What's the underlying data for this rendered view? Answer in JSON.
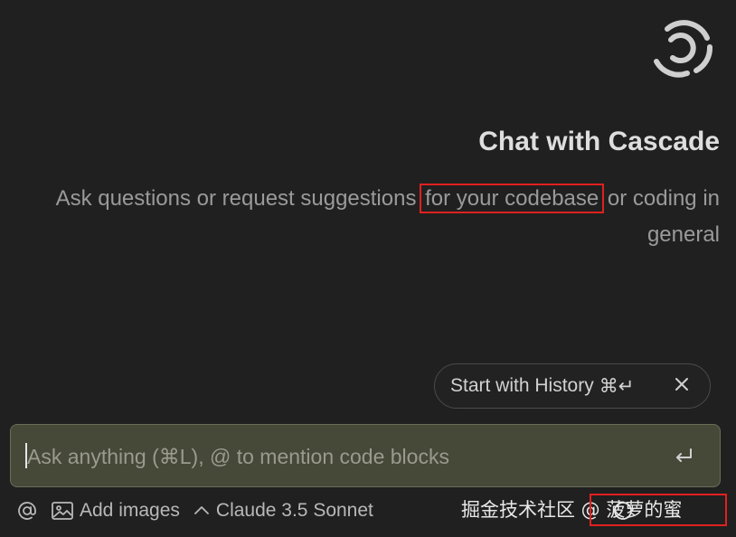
{
  "header": {
    "logo_icon": "cascade-logo-icon",
    "title": "Chat with Cascade",
    "subtitle_before": "Ask questions or request suggestions ",
    "subtitle_highlight": "for your codebase",
    "subtitle_after": " or coding in general"
  },
  "history_suggestion": {
    "label": "Start with History",
    "shortcut": "⌘↵",
    "close_icon": "close-icon"
  },
  "composer": {
    "placeholder": "Ask anything (⌘L), @ to mention code blocks",
    "value": "",
    "send_icon": "enter-icon"
  },
  "toolbar": {
    "mention_icon": "at-icon",
    "add_images_label": "Add images",
    "model_label": "Claude 3.5 Sonnet"
  },
  "watermark": {
    "text": "掘金技术社区 @ 菠萝的蜜"
  },
  "colors": {
    "background": "#202020",
    "input_background": "#464838",
    "highlight_box": "#e02020"
  }
}
